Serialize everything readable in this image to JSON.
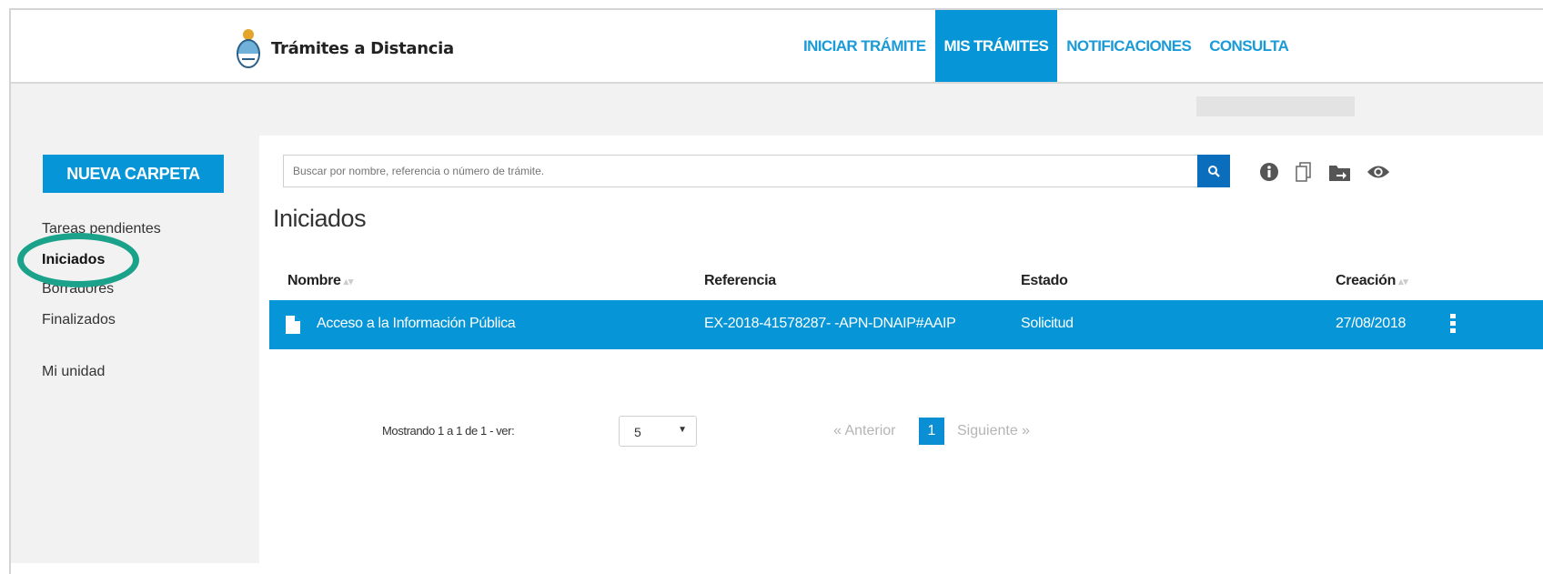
{
  "header": {
    "brand": "Trámites a Distancia",
    "nav": [
      "INICIAR TRÁMITE",
      "MIS TRÁMITES",
      "NOTIFICACIONES",
      "CONSULTA"
    ],
    "active_nav": "MIS TRÁMITES"
  },
  "sidebar": {
    "new_folder_label": "NUEVA CARPETA",
    "links": [
      "Tareas pendientes",
      "Iniciados",
      "Borradores",
      "Finalizados",
      "Mi unidad"
    ],
    "active_link": "Iniciados"
  },
  "search": {
    "placeholder": "Buscar por nombre, referencia o número de trámite."
  },
  "toolbar": {
    "icons": [
      "info-icon",
      "documents-icon",
      "move-to-folder-icon",
      "eye-icon"
    ]
  },
  "main": {
    "title": "Iniciados",
    "table": {
      "headers": [
        "Nombre",
        "Referencia",
        "Estado",
        "Creación"
      ],
      "rows": [
        {
          "nombre": "Acceso a la Información Pública",
          "referencia": "EX-2018-41578287- -APN-DNAIP#AAIP",
          "estado": "Solicitud",
          "creacion": "27/08/2018"
        }
      ]
    }
  },
  "pagination": {
    "showing": "Mostrando 1 a 1 de 1 - ver:",
    "page_size": "5",
    "prev": "« Anterior",
    "current_page": "1",
    "next": "Siguiente »"
  },
  "colors": {
    "primary": "#0695d6",
    "highlight_ring": "#1aa38a",
    "sidebar_bg": "#f2f2f2"
  }
}
